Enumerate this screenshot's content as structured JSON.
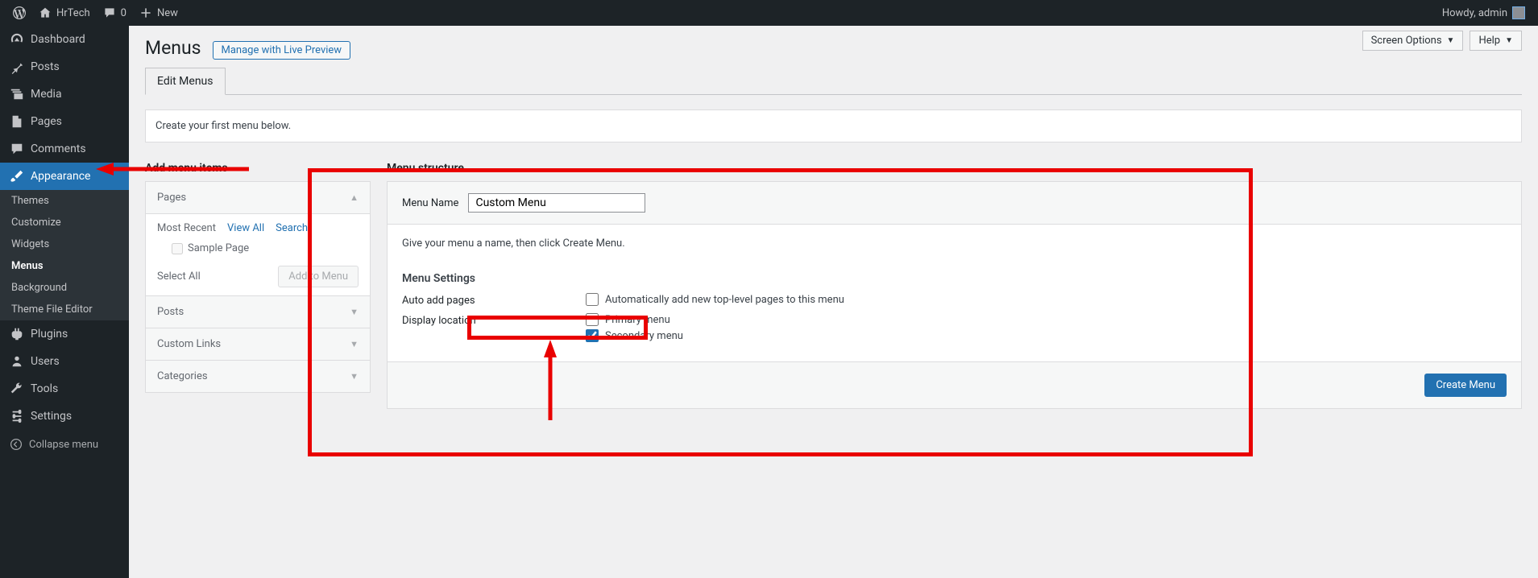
{
  "adminbar": {
    "site_name": "HrTech",
    "comments_count": "0",
    "new_label": "New",
    "howdy": "Howdy, admin"
  },
  "sidebar": {
    "items": [
      {
        "label": "Dashboard"
      },
      {
        "label": "Posts"
      },
      {
        "label": "Media"
      },
      {
        "label": "Pages"
      },
      {
        "label": "Comments"
      },
      {
        "label": "Appearance"
      },
      {
        "label": "Plugins"
      },
      {
        "label": "Users"
      },
      {
        "label": "Tools"
      },
      {
        "label": "Settings"
      }
    ],
    "submenu": [
      {
        "label": "Themes"
      },
      {
        "label": "Customize"
      },
      {
        "label": "Widgets"
      },
      {
        "label": "Menus"
      },
      {
        "label": "Background"
      },
      {
        "label": "Theme File Editor"
      }
    ],
    "collapse": "Collapse menu"
  },
  "top": {
    "screen_options": "Screen Options",
    "help": "Help"
  },
  "page": {
    "title": "Menus",
    "live_preview": "Manage with Live Preview",
    "tab": "Edit Menus",
    "notice": "Create your first menu below."
  },
  "add_items": {
    "header": "Add menu items",
    "pages": "Pages",
    "tabs": {
      "recent": "Most Recent",
      "view_all": "View All",
      "search": "Search"
    },
    "sample_page": "Sample Page",
    "select_all": "Select All",
    "add_to_menu": "Add to Menu",
    "posts": "Posts",
    "custom_links": "Custom Links",
    "categories": "Categories"
  },
  "structure": {
    "header": "Menu structure",
    "name_label": "Menu Name",
    "name_value": "Custom Menu",
    "instruction": "Give your menu a name, then click Create Menu.",
    "settings_head": "Menu Settings",
    "auto_add_label": "Auto add pages",
    "auto_add_option": "Automatically add new top-level pages to this menu",
    "display_label": "Display location",
    "primary": "Primary menu",
    "secondary": "Secondary menu",
    "create_btn": "Create Menu"
  }
}
